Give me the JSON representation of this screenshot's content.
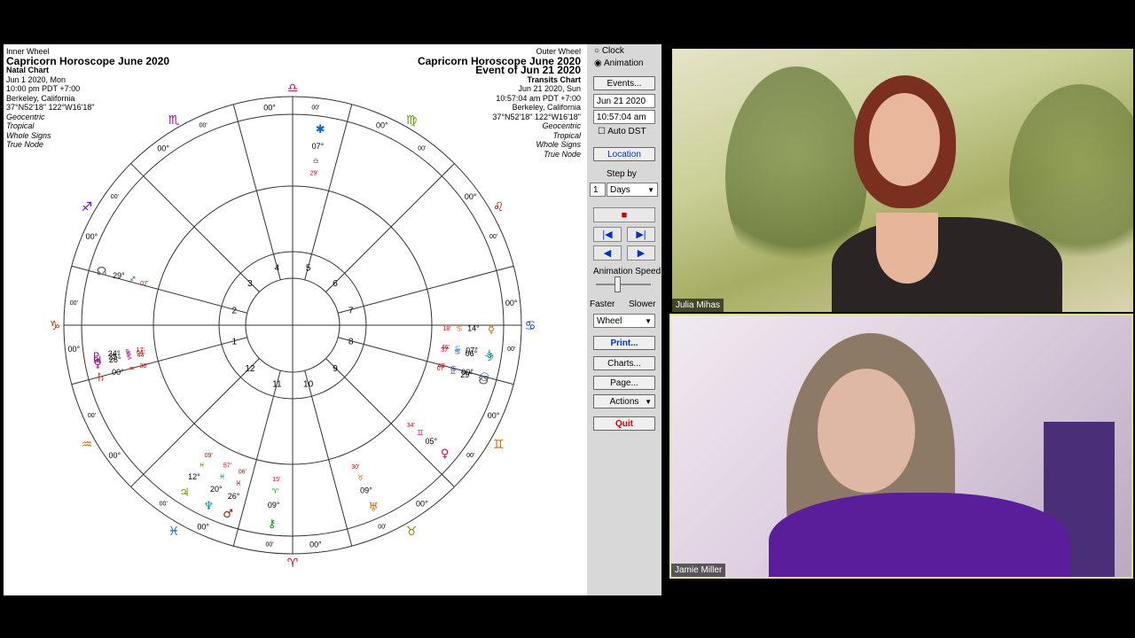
{
  "chart": {
    "left_header": {
      "wheel_label": "Inner Wheel",
      "title": "Capricorn Horoscope June 2020",
      "chart_type": "Natal Chart",
      "date": "Jun 1 2020, Mon",
      "time": "10:00 pm  PDT +7:00",
      "place": "Berkeley, California",
      "coords": "37°N52'18\" 122°W16'18\"",
      "options": [
        "Geocentric",
        "Tropical",
        "Whole Signs",
        "True Node"
      ]
    },
    "right_header": {
      "wheel_label": "Outer Wheel",
      "title": "Capricorn Horoscope June 2020",
      "event": "Event of Jun 21 2020",
      "chart_type": "Transits Chart",
      "date": "Jun 21 2020, Sun",
      "time": "10:57:04 am  PDT +7:00",
      "place": "Berkeley, California",
      "coords": "37°N52'18\" 122°W16'18\"",
      "options": [
        "Geocentric",
        "Tropical",
        "Whole Signs",
        "True Node"
      ]
    },
    "sign_degree": "00°",
    "minute_label": "00'",
    "sign_glyphs": [
      "♈",
      "♉",
      "♊",
      "♋",
      "♌",
      "♍",
      "♎",
      "♏",
      "♐",
      "♑",
      "♒",
      "♓"
    ],
    "sign_colors": [
      "#cc0000",
      "#888800",
      "#cc6600",
      "#0033cc",
      "#cc0000",
      "#669900",
      "#cc0066",
      "#990099",
      "#6600cc",
      "#cc3300",
      "#cc6600",
      "#0066cc"
    ],
    "house_numbers": [
      "1",
      "2",
      "3",
      "4",
      "5",
      "6",
      "7",
      "8",
      "9",
      "10",
      "11",
      "12"
    ],
    "planets": [
      {
        "glyph": "☊",
        "color": "#555555",
        "deg": "29°",
        "sign": "♐",
        "min": "07'"
      },
      {
        "glyph": "♇",
        "color": "#990066",
        "deg": "24°",
        "sign": "♑",
        "min": "17'"
      },
      {
        "glyph": "♃",
        "color": "#6600cc",
        "deg": "25°",
        "sign": "♑",
        "min": "04'"
      },
      {
        "glyph": "♀",
        "color": "#cc0066",
        "deg": "26°",
        "sign": "♑",
        "min": "44'"
      },
      {
        "glyph": "♄",
        "color": "#cc3300",
        "deg": "00°",
        "sign": "♒",
        "min": "38'"
      },
      {
        "glyph": "☿",
        "color": "#cc6600",
        "deg": "14°",
        "sign": "♋",
        "min": "18'"
      },
      {
        "glyph": "⚶",
        "color": "#00aa66",
        "deg": "07°",
        "sign": "♋",
        "min": "46'"
      },
      {
        "glyph": "☽",
        "color": "#0033cc",
        "deg": "06°",
        "sign": "♋",
        "min": "37'"
      },
      {
        "glyph": "☉",
        "color": "#0033cc",
        "deg": "00°",
        "sign": "♋",
        "min": "48'"
      },
      {
        "glyph": "☋",
        "color": "#555555",
        "deg": "29°",
        "sign": "♊",
        "min": "07'"
      },
      {
        "glyph": "♀",
        "color": "#cc0066",
        "deg": "05°",
        "sign": "♊",
        "min": "34'"
      },
      {
        "glyph": "♅",
        "color": "#cc6600",
        "deg": "09°",
        "sign": "♉",
        "min": "30'"
      },
      {
        "glyph": "⚷",
        "color": "#009900",
        "deg": "09°",
        "sign": "♈",
        "min": "15'"
      },
      {
        "glyph": "♂",
        "color": "#cc0000",
        "deg": "26°",
        "sign": "♓",
        "min": "06'"
      },
      {
        "glyph": "♆",
        "color": "#009999",
        "deg": "20°",
        "sign": "♓",
        "min": "57'"
      },
      {
        "glyph": "♃",
        "color": "#669900",
        "deg": "12°",
        "sign": "♓",
        "min": "09'"
      },
      {
        "glyph": "✱",
        "color": "#0066cc",
        "deg": "07°",
        "sign": "♎",
        "min": "29'"
      }
    ]
  },
  "controls": {
    "clock_label": "Clock",
    "animation_label": "Animation",
    "events_button": "Events...",
    "date_value": "Jun 21 2020",
    "time_value": "10:57:04 am",
    "auto_dst_label": "Auto DST",
    "location_button": "Location",
    "step_by_label": "Step by",
    "step_value": "1",
    "step_unit": "Days",
    "animation_speed_label": "Animation Speed",
    "faster_label": "Faster",
    "slower_label": "Slower",
    "wheel_select": "Wheel",
    "print_button": "Print...",
    "charts_button": "Charts...",
    "page_button": "Page...",
    "actions_button": "Actions",
    "quit_button": "Quit",
    "accent_red": "#cc0000",
    "accent_blue": "#0033cc"
  },
  "video": {
    "top_name": "Julia Mihas",
    "bottom_name": "Jamie Miller"
  }
}
